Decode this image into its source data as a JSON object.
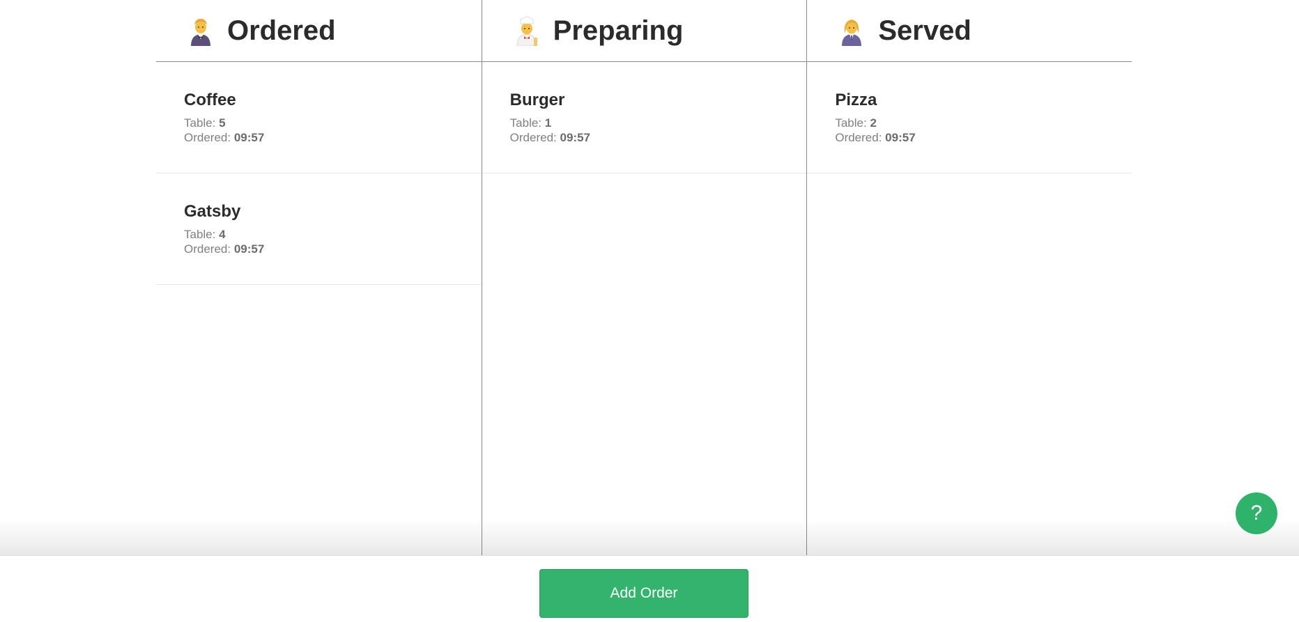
{
  "columns": [
    {
      "title": "Ordered",
      "icon": "waiter-person-icon",
      "cards": [
        {
          "name": "Coffee",
          "table_label": "Table:",
          "table": "5",
          "ordered_label": "Ordered:",
          "time": "09:57"
        },
        {
          "name": "Gatsby",
          "table_label": "Table:",
          "table": "4",
          "ordered_label": "Ordered:",
          "time": "09:57"
        }
      ]
    },
    {
      "title": "Preparing",
      "icon": "cook-icon",
      "cards": [
        {
          "name": "Burger",
          "table_label": "Table:",
          "table": "1",
          "ordered_label": "Ordered:",
          "time": "09:57"
        }
      ]
    },
    {
      "title": "Served",
      "icon": "woman-in-suit-icon",
      "cards": [
        {
          "name": "Pizza",
          "table_label": "Table:",
          "table": "2",
          "ordered_label": "Ordered:",
          "time": "09:57"
        }
      ]
    }
  ],
  "footer": {
    "add_order_label": "Add Order"
  },
  "help": {
    "label": "?"
  },
  "colors": {
    "accent": "#33b36b",
    "divider": "#8a8a8a",
    "text": "#2b2b2b",
    "muted": "#808080"
  }
}
